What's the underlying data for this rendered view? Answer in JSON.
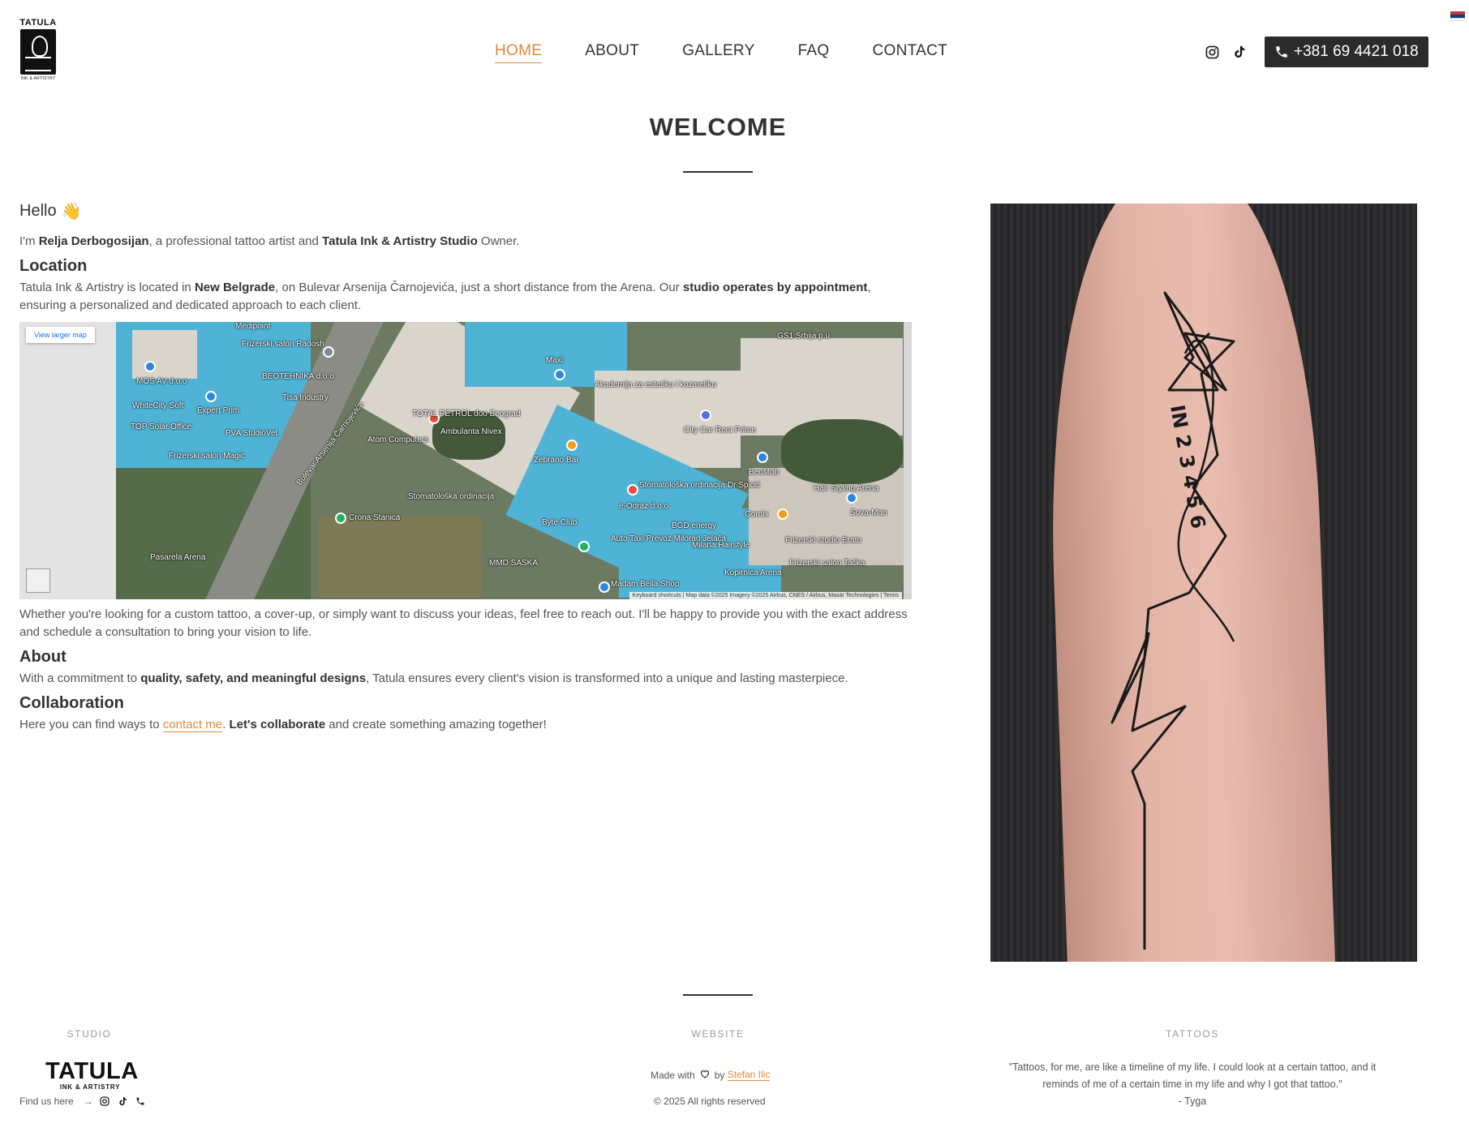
{
  "brand": {
    "logo_top": "TATULA",
    "logo_sub": "INK & ARTISTRY"
  },
  "nav": {
    "items": [
      {
        "label": "HOME",
        "active": true
      },
      {
        "label": "ABOUT",
        "active": false
      },
      {
        "label": "GALLERY",
        "active": false
      },
      {
        "label": "FAQ",
        "active": false
      },
      {
        "label": "CONTACT",
        "active": false
      }
    ],
    "accent_color": "#e08a3c"
  },
  "header": {
    "phone": "+381 69 4421 018",
    "icons": [
      "instagram-icon",
      "tiktok-icon",
      "phone-icon"
    ],
    "language_flag": "serbian-flag"
  },
  "welcome": {
    "title": "WELCOME"
  },
  "intro": {
    "greeting": "Hello",
    "greeting_emoji": "👋",
    "intro_pre": "I'm ",
    "artist_name": "Relja Derbogosijan",
    "intro_mid": ", a professional tattoo artist and ",
    "studio_name": "Tatula Ink & Artistry Studio",
    "intro_post": " Owner."
  },
  "location": {
    "heading": "Location",
    "text_pre": "Tatula Ink & Artistry is located in ",
    "place": "New Belgrade",
    "text_mid": ", on Bulevar Arsenija Čarnojevića, just a short distance from the Arena. Our ",
    "appointment": "studio operates by appointment",
    "text_post": ", ensuring a personalized and dedicated approach to each client."
  },
  "map": {
    "view_larger": "View larger map",
    "attribution": "Keyboard shortcuts  |  Map data ©2025 Imagery ©2025 Airbus, CNES / Airbus, Maxar Technologies  |  Terms",
    "labels": [
      "Medipoint",
      "Frizerski salon Radosh",
      "MOS AV d.o.o",
      "BEOTEHNIKA d.o.o",
      "WhiteCity Soft",
      "Expert Prim",
      "TOP Solar Office",
      "Tisa Industry",
      "PVA StudioVet",
      "Frizerski salon Magic",
      "TOTAL PETROL doo Beograd",
      "Ambulanta Nivex",
      "Atom Computers",
      "Bulevar Arsenija Čarnojevića",
      "Maxi",
      "Akademija za estetiku i kozmetiku",
      "Zebrano Bar",
      "City Car Rent Prime",
      "GS1 Srbija p.u",
      "BeoMob",
      "Hair Styling Arena",
      "Stomatološka ordinacija",
      "Stomatološka ordinacija Dr Spicić",
      "e-Odraz d.o.o",
      "BGD energy",
      "Gornix",
      "Byte Club",
      "Pasarela Arena",
      "Auto Taxi Prevoz Milorad Jelača",
      "Milana Hairstyle",
      "Frizerski studio Erato",
      "Sova-Man",
      "MMD SASKA",
      "Madam Bella Shop",
      "Kopirnica Arena",
      "Frizerski salon Tačka",
      "Crona Stanica"
    ]
  },
  "after_map": {
    "text": "Whether you're looking for a custom tattoo, a cover-up, or simply want to discuss your ideas, feel free to reach out. I'll be happy to provide you with the exact address and schedule a consultation to bring your vision to life."
  },
  "about": {
    "heading": "About",
    "text_pre": "With a commitment to ",
    "highlight": "quality, safety, and meaningful designs",
    "text_post": ", Tatula ensures every client's vision is transformed into a unique and lasting masterpiece."
  },
  "collaboration": {
    "heading": "Collaboration",
    "text_pre": "Here you can find ways to ",
    "link": "contact me",
    "text_mid": ". ",
    "highlight": "Let's collaborate",
    "text_post": " and create something amazing together!"
  },
  "footer": {
    "studio_label": "STUDIO",
    "website_label": "WEBSITE",
    "tattoos_label": "TATTOOS",
    "logo_big": "TATULA",
    "logo_small": "INK & ARTISTRY",
    "find_us": "Find us here",
    "find_arrow": "→",
    "made_with_pre": "Made with",
    "made_with_by": "by",
    "author": "Stefan Ilic",
    "rights": "© 2025 All rights reserved",
    "quote": "\"Tattoos, for me, are like a timeline of my life. I could look at a certain tattoo, and it reminds of me of a certain time in my life and why I got that tattoo.\"",
    "quote_author": "- Tyga"
  }
}
